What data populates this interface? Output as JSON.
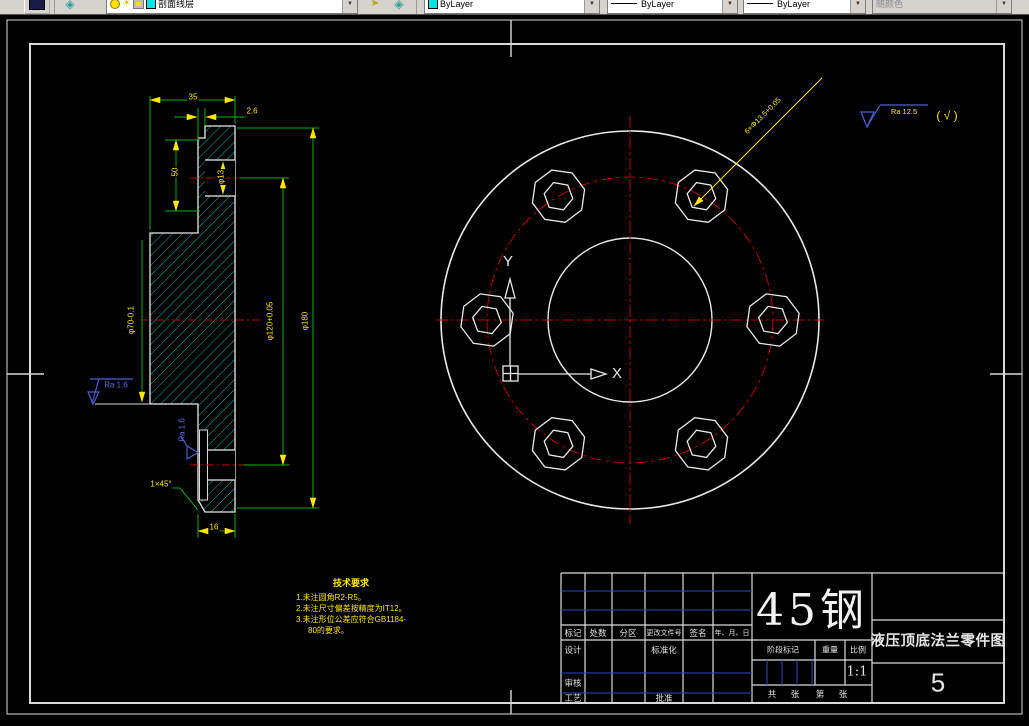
{
  "toolbar": {
    "layer_dropdown": {
      "value": "剖面线层"
    },
    "color_dropdown": {
      "value": "ByLayer"
    },
    "linetype_dropdown": {
      "value": "ByLayer"
    },
    "lineweight_dropdown": {
      "value": "ByLayer"
    },
    "plotstyle_dropdown": {
      "value": "随颜色"
    }
  },
  "section_view": {
    "dim_width": "35",
    "dim_step": "2.6",
    "dim_depth": "50",
    "dim_hole": "φ13",
    "dim_bolt_circle": "φ120+0.05",
    "dim_outer_dia": "φ180",
    "dim_bore": "φ70-0.1",
    "dim_thickness": "16",
    "chamfer": "1×45°",
    "ra_left": "Ra 1.6",
    "ra_edge": "Ra 1.6"
  },
  "front_view": {
    "holes_note": "6×Φ13.5+0.05",
    "axis_x": "X",
    "axis_y": "Y"
  },
  "surface_note": {
    "ra": "Ra 12.5",
    "rest": "( √ )"
  },
  "tech_req": {
    "title": "技术要求",
    "line1": "1.未注圆角R2-R5。",
    "line2": "2.未注尺寸偏差按精度为IT12。",
    "line3": "3.未注形位公差应符合GB1184-",
    "line4": "80的要求。"
  },
  "title_block": {
    "material": "45钢",
    "title": "液压顶底法兰零件图",
    "number": "5",
    "scale_value": "1:1",
    "labels": {
      "mark": "标记",
      "count": "处数",
      "zone": "分区",
      "change_file": "更改文件号",
      "signature": "签名",
      "date": "年、月、日",
      "design": "设计",
      "standardize": "标准化",
      "review": "审核",
      "process": "工艺",
      "approve": "批准",
      "stage": "阶段标记",
      "weight": "重量",
      "scale": "比例",
      "total": "共",
      "sheet": "张",
      "page": "第"
    }
  },
  "colors": {
    "hatch": "#00cfcf",
    "dimension": "#00b400",
    "dim_text": "#ffe600",
    "centerline": "#c00000",
    "annotation_blue": "#4b5fd6",
    "outline": "#e9e9e9"
  }
}
